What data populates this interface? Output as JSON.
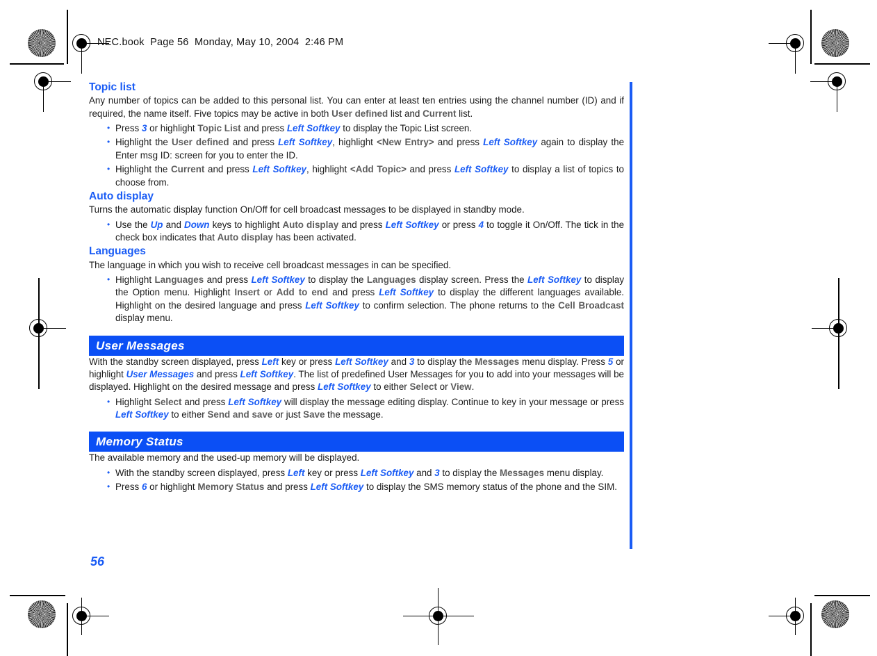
{
  "page_header": "NEC.book  Page 56  Monday, May 10, 2004  2:46 PM",
  "folio": "56",
  "colors": {
    "accent_blue": "#1a5cf5",
    "band_blue": "#0b4ff5",
    "menu_gray": "#5d5d5d",
    "body_black": "#1a1a1a"
  },
  "sections": {
    "topic_list": {
      "heading": "Topic list",
      "intro_1": "Any number of topics can be added to this personal list. You can enter at least ten entries using the channel number (ID) and if required, the name itself. Five topics may be active in both ",
      "intro_user_defined": "User defined",
      "intro_2": " list and ",
      "intro_current": "Current",
      "intro_3": " list.",
      "bullets": [
        {
          "t1": "Press ",
          "k1": "3",
          "t2": " or highlight ",
          "g1": "Topic List",
          "t3": " and press ",
          "k2": "Left Softkey",
          "t4": " to display the Topic List screen."
        },
        {
          "t1": "Highlight the ",
          "g1": "User defined",
          "t2": " and press ",
          "k1": "Left Softkey",
          "t3": ", highlight ",
          "g2": "<New Entry>",
          "t4": " and press ",
          "k2": "Left Softkey",
          "t5": " again to display the Enter msg ID: screen for you to enter the ID."
        },
        {
          "t1": "Highlight the ",
          "g1": "Current",
          "t2": " and press ",
          "k1": "Left Softkey",
          "t3": ", highlight ",
          "g2": "<Add Topic>",
          "t4": " and press ",
          "k2": "Left Softkey",
          "t5": " to display a list of topics to choose from."
        }
      ]
    },
    "auto_display": {
      "heading": "Auto display",
      "intro": "Turns the automatic display function  On/Off for cell broadcast messages to be displayed in standby mode.",
      "bullet": {
        "t1": "Use the ",
        "k1": "Up",
        "t2": " and ",
        "k2": "Down",
        "t3": " keys to highlight ",
        "g1": "Auto display",
        "t4": " and press ",
        "k3": "Left Softkey",
        "t5": " or press ",
        "k4": "4",
        "t6": " to toggle it On/Off. The tick in the check box indicates that ",
        "g2": "Auto display",
        "t7": " has been activated."
      }
    },
    "languages": {
      "heading": "Languages",
      "intro": "The language in which you wish to receive cell broadcast messages in can be specified.",
      "bullet": {
        "t1": "Highlight ",
        "g1": "Languages",
        "t2": " and press ",
        "k1": "Left Softkey",
        "t3": " to display the ",
        "g2": "Languages",
        "t4": " display screen. Press the ",
        "k2": "Left Softkey",
        "t5": " to display the Option menu. Highlight ",
        "g3": "Insert",
        "t6": " or ",
        "g4": "Add to end",
        "t7": " and press ",
        "k3": "Left Softkey",
        "t8": " to display the different languages available. Highlight on the desired language and press ",
        "k4": "Left Softkey",
        "t9": " to confirm selection. The phone returns to the ",
        "g5": "Cell Broadcast",
        "t10": " display menu."
      }
    },
    "user_messages": {
      "band_title": "User Messages",
      "para": {
        "t1": "With the standby screen displayed, press ",
        "k1": "Left",
        "t2": " key or press ",
        "k2": "Left Softkey",
        "t3": " and ",
        "k3": "3",
        "t4": " to display the ",
        "g1": "Messages",
        "t5": " menu display. Press ",
        "k4": "5",
        "t6": " or highlight ",
        "b1": "User Messages",
        "t7": " and press ",
        "k5": "Left Softkey",
        "t8": ". The list of predefined User Messages for you to add into your messages will be displayed. Highlight on the desired message and press ",
        "k6": "Left Softkey",
        "t9": " to either ",
        "g2": "Select",
        "t10": " or ",
        "g3": "View",
        "t11": "."
      },
      "bullet": {
        "t1": "Highlight ",
        "g1": "Select",
        "t2": " and press ",
        "k1": "Left Softkey",
        "t3": " will display the message editing display. Continue to key in your message or press ",
        "k2": "Left Softkey",
        "t4": " to either ",
        "g2": "Send and save",
        "t5": " or just ",
        "g3": "Save",
        "t6": " the message."
      }
    },
    "memory_status": {
      "band_title": "Memory Status",
      "intro": "The available memory and the used-up memory will be displayed.",
      "bullets": [
        {
          "t1": "With the standby screen displayed, press ",
          "k1": "Left",
          "t2": " key or press ",
          "k2": "Left Softkey",
          "t3": " and ",
          "k3": "3",
          "t4": " to display the ",
          "g1": "Messages",
          "t5": " menu display."
        },
        {
          "t1": "Press ",
          "k1": "6",
          "t2": " or highlight ",
          "g1": "Memory Status",
          "t3": " and press ",
          "k2": "Left Softkey",
          "t4": " to display the SMS memory status of the phone and the SIM."
        }
      ]
    }
  }
}
